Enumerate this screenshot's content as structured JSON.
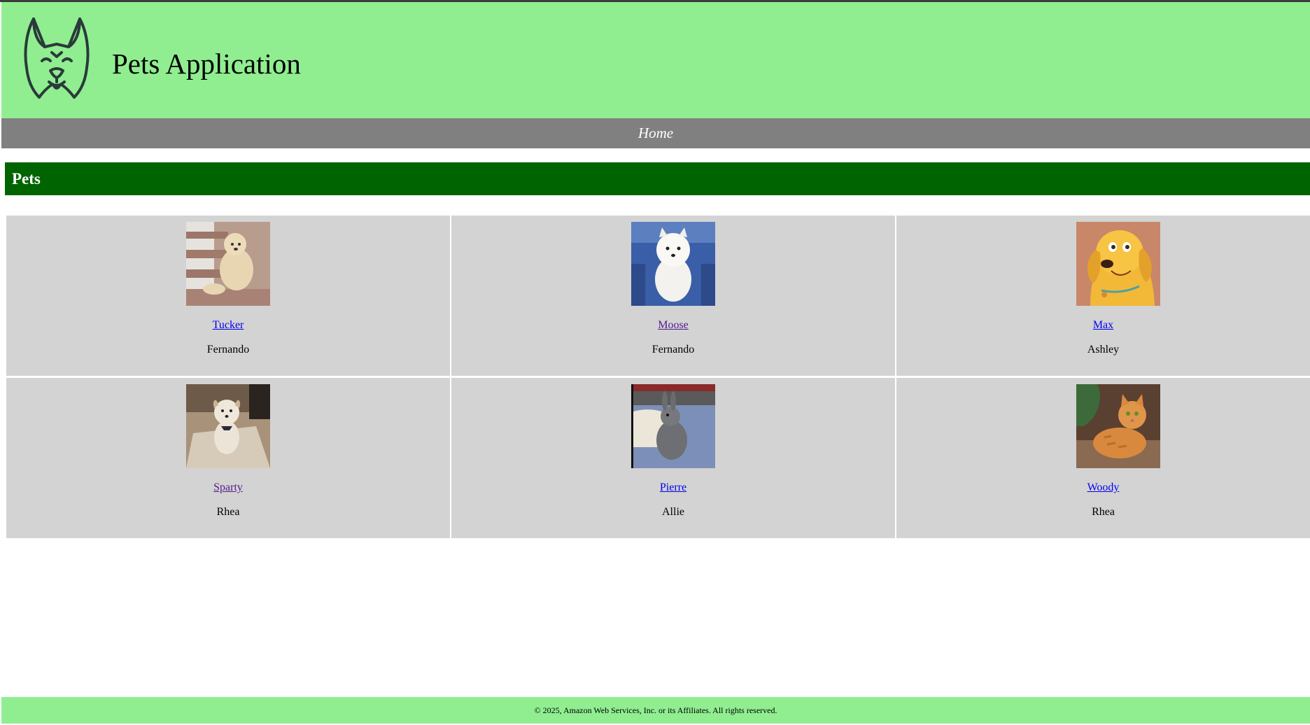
{
  "header": {
    "title": "Pets Application",
    "logo_icon": "dog-face-icon",
    "background": "#90ee90"
  },
  "nav": {
    "home_label": "Home",
    "background": "#808080"
  },
  "section": {
    "title": "Pets",
    "background": "#006400"
  },
  "pets": [
    {
      "name": "Tucker",
      "owner": "Fernando",
      "link_visited": false,
      "photo": "golden-dog-on-stairs"
    },
    {
      "name": "Moose",
      "owner": "Fernando",
      "link_visited": true,
      "photo": "white-fluffy-dog-on-chair"
    },
    {
      "name": "Max",
      "owner": "Ashley",
      "link_visited": false,
      "photo": "cartoon-golden-retriever"
    },
    {
      "name": "Sparty",
      "owner": "Rhea",
      "link_visited": true,
      "photo": "small-shaggy-dog"
    },
    {
      "name": "Pierre",
      "owner": "Allie",
      "link_visited": false,
      "photo": "gray-rabbit-on-blanket"
    },
    {
      "name": "Woody",
      "owner": "Rhea",
      "link_visited": false,
      "photo": "orange-tabby-cat"
    }
  ],
  "footer": {
    "text": "© 2025, Amazon Web Services, Inc. or its Affiliates. All rights reserved.",
    "background": "#90ee90"
  }
}
